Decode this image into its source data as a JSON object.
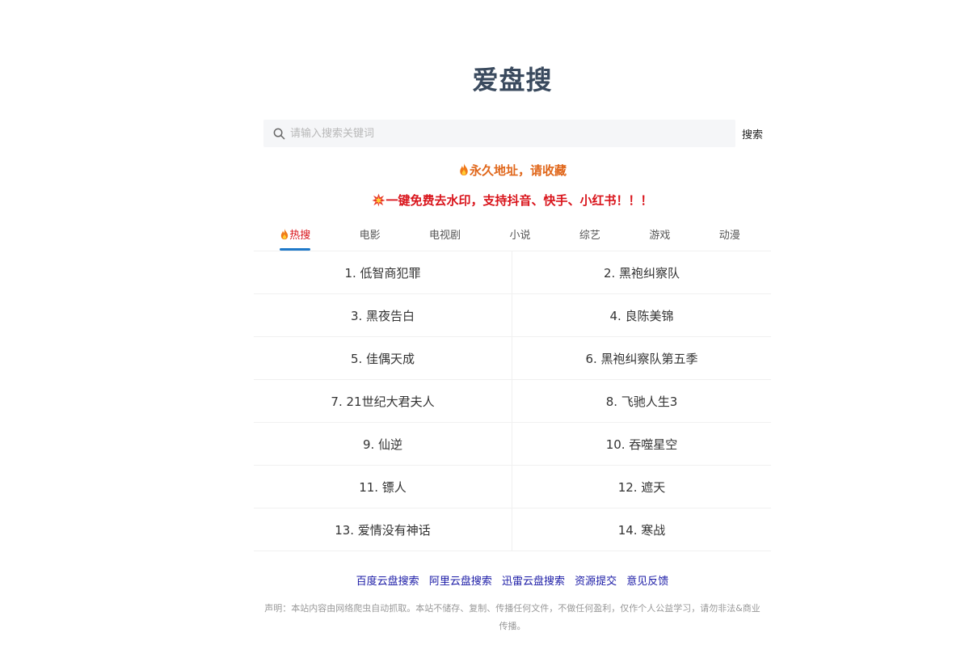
{
  "header": {
    "site_title": "爱盘搜"
  },
  "search": {
    "placeholder": "请输入搜索关键词",
    "value": "",
    "button_label": "搜索"
  },
  "notices": {
    "permanent": "永久地址，请收藏",
    "watermark": "一键免费去水印，支持抖音、快手、小红书！！！"
  },
  "tabs": [
    {
      "label": "热搜",
      "active": true,
      "icon": "fire-icon"
    },
    {
      "label": "电影"
    },
    {
      "label": "电视剧"
    },
    {
      "label": "小说"
    },
    {
      "label": "综艺"
    },
    {
      "label": "游戏"
    },
    {
      "label": "动漫"
    }
  ],
  "hot_list": [
    "1. 低智商犯罪",
    "2. 黑袍纠察队",
    "3. 黑夜告白",
    "4. 良陈美锦",
    "5. 佳偶天成",
    "6. 黑袍纠察队第五季",
    "7. 21世纪大君夫人",
    "8. 飞驰人生3",
    "9. 仙逆",
    "10. 吞噬星空",
    "11. 镖人",
    "12. 遮天",
    "13. 爱情没有神话",
    "14. 寒战"
  ],
  "footer": {
    "links": [
      "百度云盘搜索",
      "阿里云盘搜索",
      "迅雷云盘搜索",
      "资源提交",
      "意见反馈"
    ],
    "disclaimer": "声明：本站内容由网络爬虫自动抓取。本站不储存、复制、传播任何文件，不做任何盈利，仅作个人公益学习，请勿非法&商业传播。"
  },
  "colors": {
    "title": "#3a4a5e",
    "notice_orange": "#e0671b",
    "notice_red": "#d9141b",
    "tab_underline": "#1f79c9",
    "link": "#1a1aa6"
  }
}
